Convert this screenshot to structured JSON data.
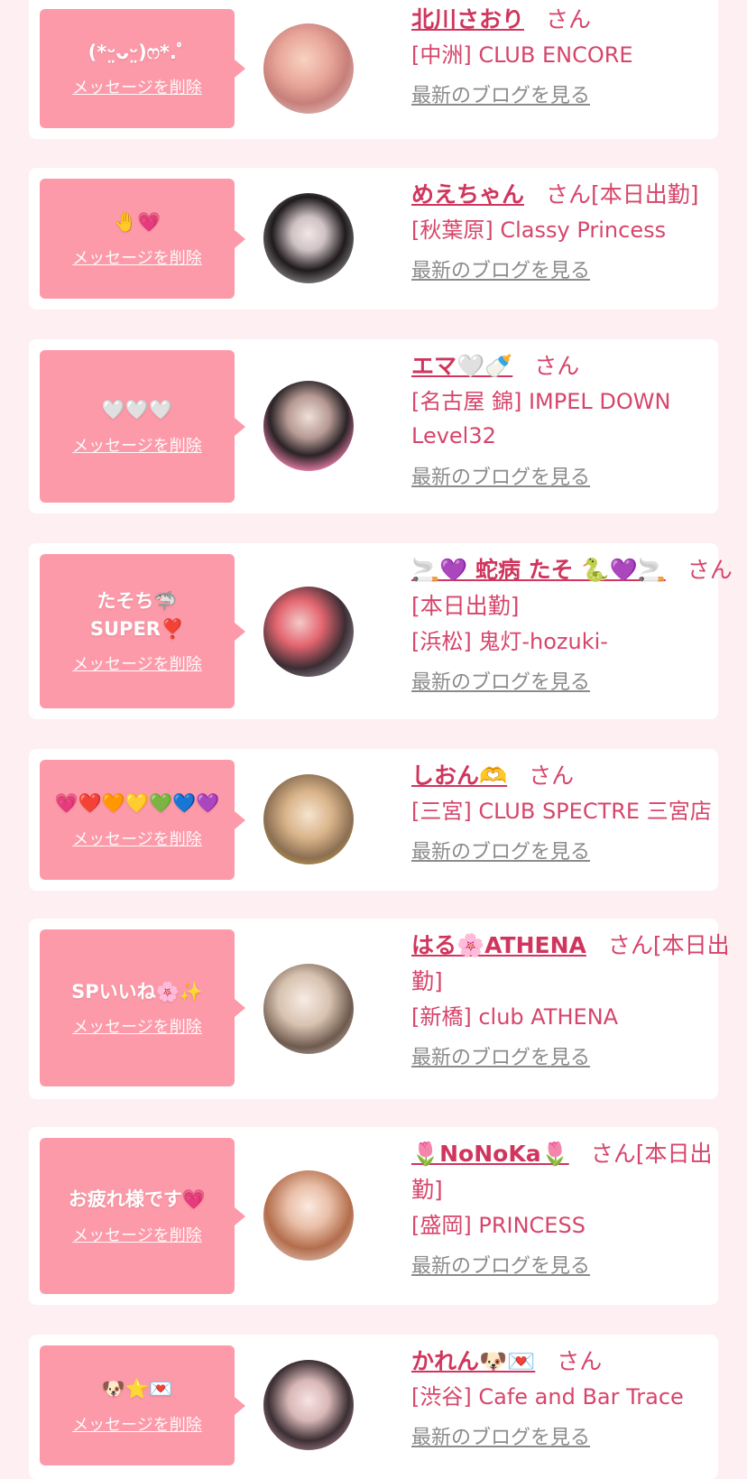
{
  "delete_label": "メッセージを削除",
  "blog_label": "最新のブログを見る",
  "honorific": "さん",
  "colors": {
    "bubble": "#fd9aa9",
    "name": "#d0365d",
    "link": "#8b8b8b",
    "background": "#fdeff2"
  },
  "cards": [
    {
      "message": "(*ᵕ̤ᴗᵕ̤)ෆ*.ﾟ",
      "name": "北川さおり",
      "suffix": "さん",
      "shop": "[中洲] CLUB ENCORE"
    },
    {
      "message": "🤚💗",
      "name": "めえちゃん",
      "suffix": "さん[本日出勤]",
      "shop": "[秋葉原] Classy Princess"
    },
    {
      "message": "🤍🤍🤍",
      "name": "エマ🤍🍼",
      "suffix": "さん",
      "shop": "[名古屋 錦] IMPEL DOWN Level32"
    },
    {
      "message": "たそち🦈 SUPER❣️",
      "name": "🚬💜 蛇病 たそ 🐍💜🚬",
      "suffix": "さん[本日出勤]",
      "shop": "[浜松] 鬼灯-hozuki-"
    },
    {
      "message": "💗❤️🧡💛💚💙💜",
      "name": "しおん🫶",
      "suffix": "さん",
      "shop": "[三宮] CLUB SPECTRE 三宮店"
    },
    {
      "message": "SPいいね🌸✨",
      "name": "はる🌸ATHENA",
      "suffix": "さん[本日出勤]",
      "shop": "[新橋] club ATHENA"
    },
    {
      "message": "お疲れ様です💗",
      "name": "🌷NoNoKa🌷",
      "suffix": "さん[本日出勤]",
      "shop": "[盛岡] PRINCESS"
    },
    {
      "message": "🐶⭐💌",
      "name": "かれん🐶💌",
      "suffix": "さん",
      "shop": "[渋谷] Cafe and Bar Trace"
    }
  ]
}
